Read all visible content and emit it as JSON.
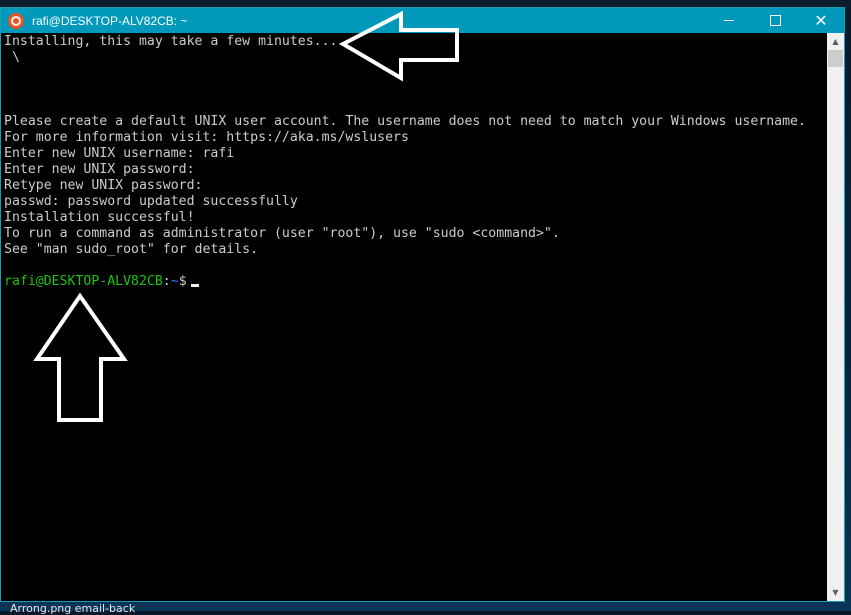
{
  "desktop": {
    "taskbar_label": "Arrong.png   email-back"
  },
  "window": {
    "title": "rafi@DESKTOP-ALV82CB: ~",
    "app_icon": "ubuntu-icon",
    "buttons": {
      "minimize": "minimize-icon",
      "maximize": "maximize-icon",
      "close": "✕"
    },
    "accent_color": "#0099bc"
  },
  "console": {
    "lines": [
      "Installing, this may take a few minutes...",
      " \\",
      "",
      "",
      "",
      "Please create a default UNIX user account. The username does not need to match your Windows username.",
      "For more information visit: https://aka.ms/wslusers",
      "Enter new UNIX username: rafi",
      "Enter new UNIX password:",
      "Retype new UNIX password:",
      "passwd: password updated successfully",
      "Installation successful!",
      "To run a command as administrator (user \"root\"), use \"sudo <command>\".",
      "See \"man sudo_root\" for details.",
      ""
    ],
    "prompt": {
      "user_host": "rafi@DESKTOP-ALV82CB",
      "separator": ":",
      "path": "~",
      "symbol": "$"
    },
    "colors": {
      "text": "#cccccc",
      "prompt_user": "#16c60c",
      "prompt_path": "#3b78ff"
    }
  },
  "scrollbar": {
    "up": "▲",
    "down": "▼",
    "position": 0
  },
  "annotations": [
    {
      "type": "arrow-left-outline",
      "points_to": "Installing line"
    },
    {
      "type": "arrow-up-outline",
      "points_to": "prompt"
    }
  ]
}
